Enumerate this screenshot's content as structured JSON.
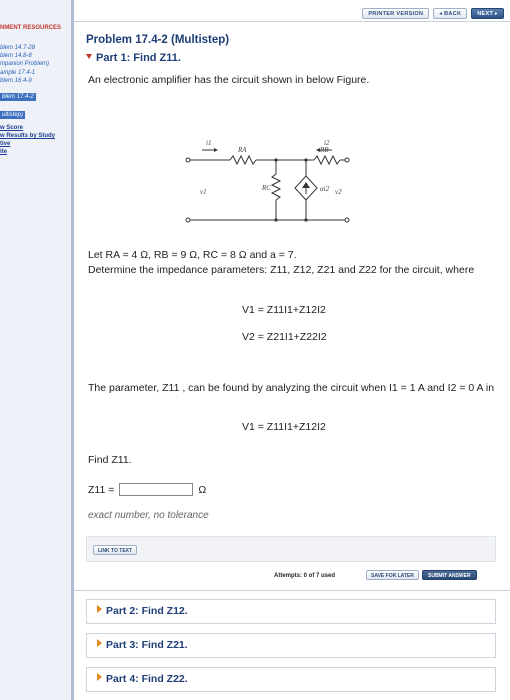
{
  "sidebar": {
    "heading": "NMENT RESOURCES",
    "items": [
      {
        "label": "blem 14.7-28",
        "selected": false
      },
      {
        "label": "blem 14.8-8",
        "selected": false
      },
      {
        "label": "mpanion Problem)",
        "selected": false
      },
      {
        "label": "ample 17.4-1",
        "selected": false
      },
      {
        "label": "blem 16.4-9",
        "selected": false
      },
      {
        "label": "blem 17.4-2",
        "selected": true
      },
      {
        "label": "ultistep)",
        "selected": true
      }
    ],
    "links": [
      "w Score",
      "w Results by Study",
      "tive",
      "ite"
    ]
  },
  "toolbar": {
    "printer_label": "PRINTER VERSION",
    "back_label": "◂ BACK",
    "next_label": "NEXT ▸"
  },
  "problem": {
    "title": "Problem 17.4-2 (Multistep)",
    "part1_title": "Part 1: Find Z11.",
    "intro": "An electronic amplifier has the circuit shown in below Figure.",
    "given": "Let RA = 4 Ω, RB = 9 Ω, RC = 8 Ω and a = 7.",
    "determine": "Determine the impedance parameters: Z11, Z12, Z21 and Z22 for the circuit, where",
    "eq1": "V1 = Z11I1+Z12I2",
    "eq2": "V2 = Z21I1+Z22I2",
    "parameter_text": "The parameter, Z11 , can be found by analyzing the circuit when I1 = 1 A and I2 = 0 A in",
    "eq3": "V1 = Z11I1+Z12I2",
    "find_text": "Find Z11.",
    "answer_label": "Z11 =",
    "answer_unit": "Ω",
    "hint": "exact number, no tolerance"
  },
  "circuit": {
    "i1": "i1",
    "i2": "i2",
    "ra": "RA",
    "rb": "RB",
    "rc": "RC",
    "v1": "v1",
    "v2": "v2",
    "source": "αi2"
  },
  "actions": {
    "link_to_text": "LINK TO TEXT",
    "attempts": "Attempts: 0 of 7 used",
    "save_later": "SAVE FOR LATER",
    "submit": "SUBMIT ANSWER"
  },
  "parts": [
    {
      "label": "Part 2: Find Z12."
    },
    {
      "label": "Part 3: Find Z21."
    },
    {
      "label": "Part 4: Find Z22."
    }
  ],
  "colors": {
    "heading_blue": "#1f3e78",
    "accent_red": "#c0392b",
    "part_arrow_orange": "#e08a1e",
    "sidebar_bg": "#eef2f8"
  }
}
